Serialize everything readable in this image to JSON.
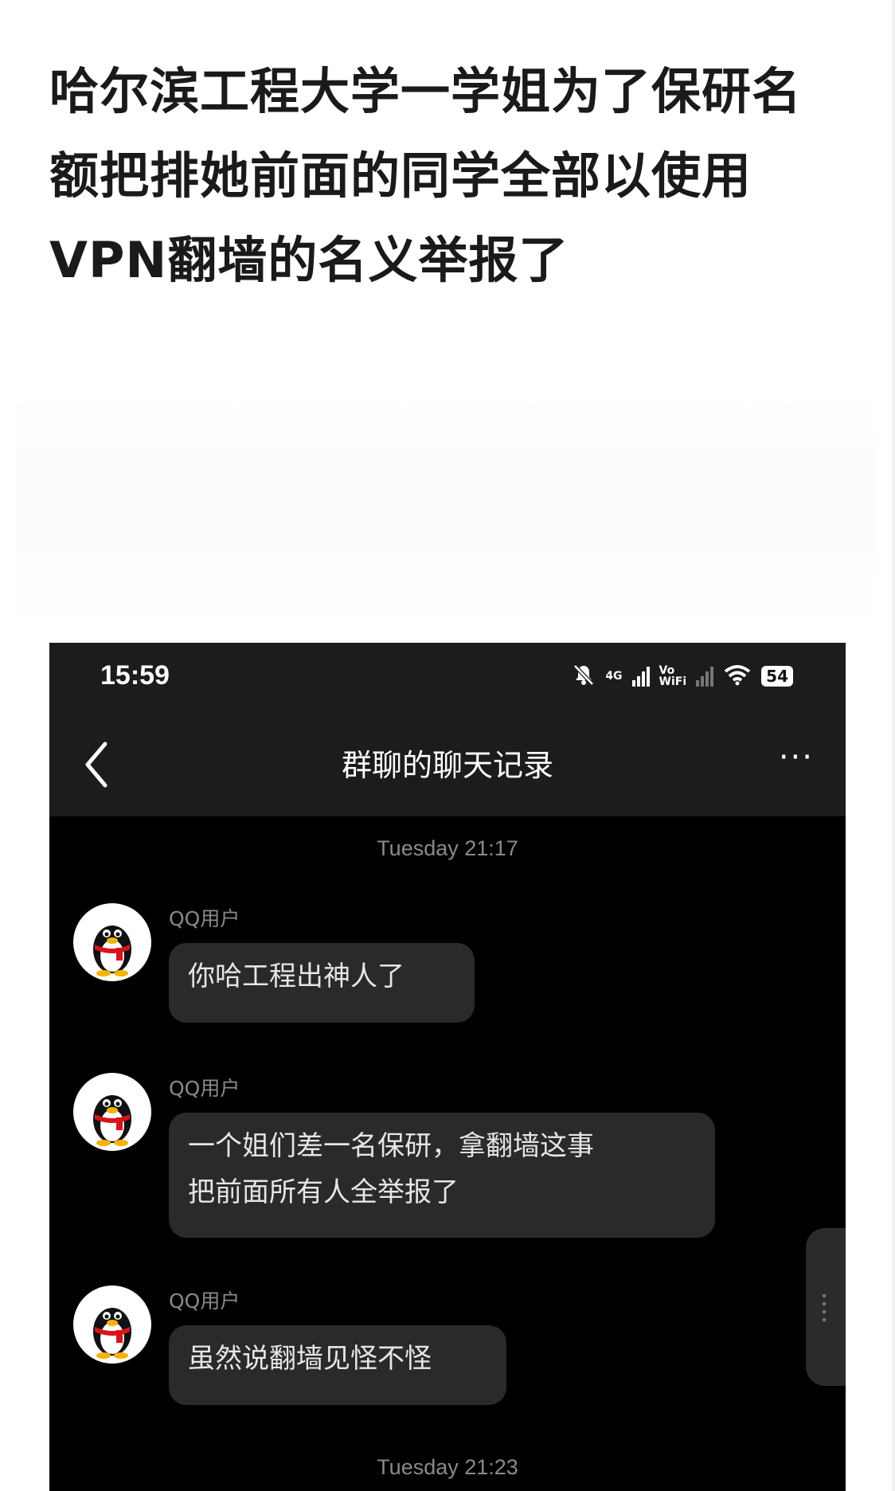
{
  "headline": "哈尔滨工程大学一学姐为了保研名额把排她前面的同学全部以使用VPN翻墙的名义举报了",
  "status_bar": {
    "time": "15:59",
    "network": "4G",
    "volte_top": "Vo",
    "volte_bottom": "WiFi",
    "battery": "54"
  },
  "nav": {
    "title": "群聊的聊天记录",
    "more_label": "···"
  },
  "timestamps": [
    "Tuesday 21:17",
    "Tuesday 21:23"
  ],
  "messages": [
    {
      "sender": "QQ用户",
      "lines": [
        "你哈工程出神人了"
      ]
    },
    {
      "sender": "QQ用户",
      "lines": [
        "一个姐们差一名保研，拿翻墙这事",
        "把前面所有人全举报了"
      ]
    },
    {
      "sender": "QQ用户",
      "lines": [
        "虽然说翻墙见怪不怪"
      ]
    }
  ],
  "colors": {
    "chat_bg": "#000000",
    "bar_bg": "#1c1c1c",
    "bubble_bg": "#2a2a2a",
    "meta_text": "#8a8a8a"
  },
  "icons": [
    "mute-icon",
    "signal-icon",
    "wifi-icon",
    "battery-icon",
    "back-icon",
    "more-icon",
    "qq-penguin-avatar"
  ]
}
